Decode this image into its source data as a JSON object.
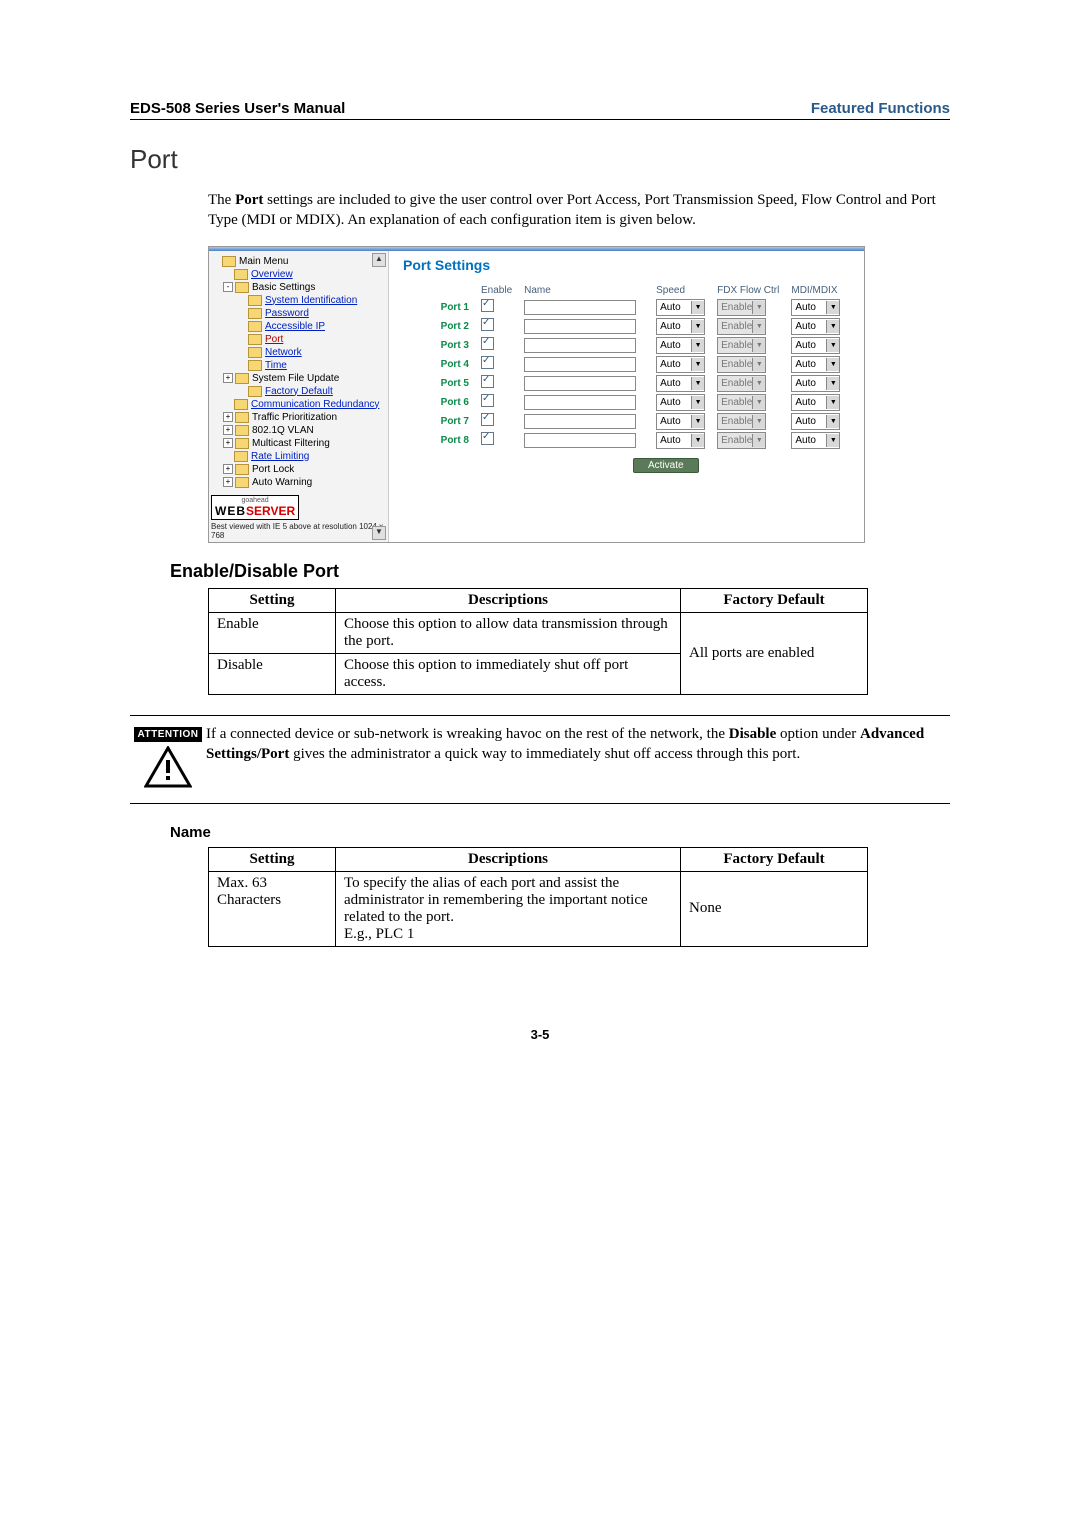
{
  "header": {
    "left": "EDS-508 Series User's Manual",
    "right": "Featured Functions"
  },
  "title": "Port",
  "intro": "The Port settings are included to give the user control over Port Access, Port Transmission Speed, Flow Control and Port Type (MDI or MDIX). An explanation of each configuration item is given below.",
  "screenshot": {
    "panel_title": "Port Settings",
    "columns": {
      "c1": "",
      "c2": "Enable",
      "c3": "Name",
      "c4": "Speed",
      "c5": "FDX Flow Ctrl",
      "c6": "MDI/MDIX"
    },
    "rows": [
      {
        "port": "Port 1",
        "speed": "Auto",
        "flow": "Enable",
        "mdi": "Auto"
      },
      {
        "port": "Port 2",
        "speed": "Auto",
        "flow": "Enable",
        "mdi": "Auto"
      },
      {
        "port": "Port 3",
        "speed": "Auto",
        "flow": "Enable",
        "mdi": "Auto"
      },
      {
        "port": "Port 4",
        "speed": "Auto",
        "flow": "Enable",
        "mdi": "Auto"
      },
      {
        "port": "Port 5",
        "speed": "Auto",
        "flow": "Enable",
        "mdi": "Auto"
      },
      {
        "port": "Port 6",
        "speed": "Auto",
        "flow": "Enable",
        "mdi": "Auto"
      },
      {
        "port": "Port 7",
        "speed": "Auto",
        "flow": "Enable",
        "mdi": "Auto"
      },
      {
        "port": "Port 8",
        "speed": "Auto",
        "flow": "Enable",
        "mdi": "Auto"
      }
    ],
    "activate": "Activate",
    "nav": {
      "main_menu": "Main Menu",
      "overview": "Overview",
      "basic_settings": "Basic Settings",
      "system_identification": "System Identification",
      "password": "Password",
      "accessible_ip": "Accessible IP",
      "port": "Port",
      "network": "Network",
      "time": "Time",
      "system_file_update": "System File Update",
      "factory_default": "Factory Default",
      "comm_redundancy": "Communication Redundancy",
      "traffic_prioritization": "Traffic Prioritization",
      "vlan": "802.1Q VLAN",
      "multicast_filtering": "Multicast Filtering",
      "rate_limiting": "Rate Limiting",
      "port_lock": "Port Lock",
      "auto_warning": "Auto Warning"
    },
    "logo": {
      "top": "goahead",
      "web": "WEB",
      "server": "SERVER"
    },
    "viewed_note": "Best viewed with IE 5 above at resolution 1024 x 768"
  },
  "enable_section": {
    "heading": "Enable/Disable Port",
    "th1": "Setting",
    "th2": "Descriptions",
    "th3": "Factory Default",
    "r1c1": "Enable",
    "r1c2": "Choose this option to allow data transmission through the port.",
    "r2c1": "Disable",
    "r2c2": "Choose this option to immediately shut off port access.",
    "default": "All ports are enabled"
  },
  "attention": {
    "label": "ATTENTION",
    "text_before": "If a connected device or sub-network is wreaking havoc on the rest of the network, the ",
    "bold1": "Disable",
    "mid": " option under ",
    "bold2": "Advanced Settings/Port",
    "after": " gives the administrator a quick way to immediately shut off access through this port."
  },
  "name_section": {
    "heading": "Name",
    "th1": "Setting",
    "th2": "Descriptions",
    "th3": "Factory Default",
    "r1c1": "Max. 63 Characters",
    "r1c2": "To specify the alias of each port and assist the administrator in remembering the important notice related to the port.\nE.g., PLC 1",
    "default": "None"
  },
  "page_num": "3-5"
}
